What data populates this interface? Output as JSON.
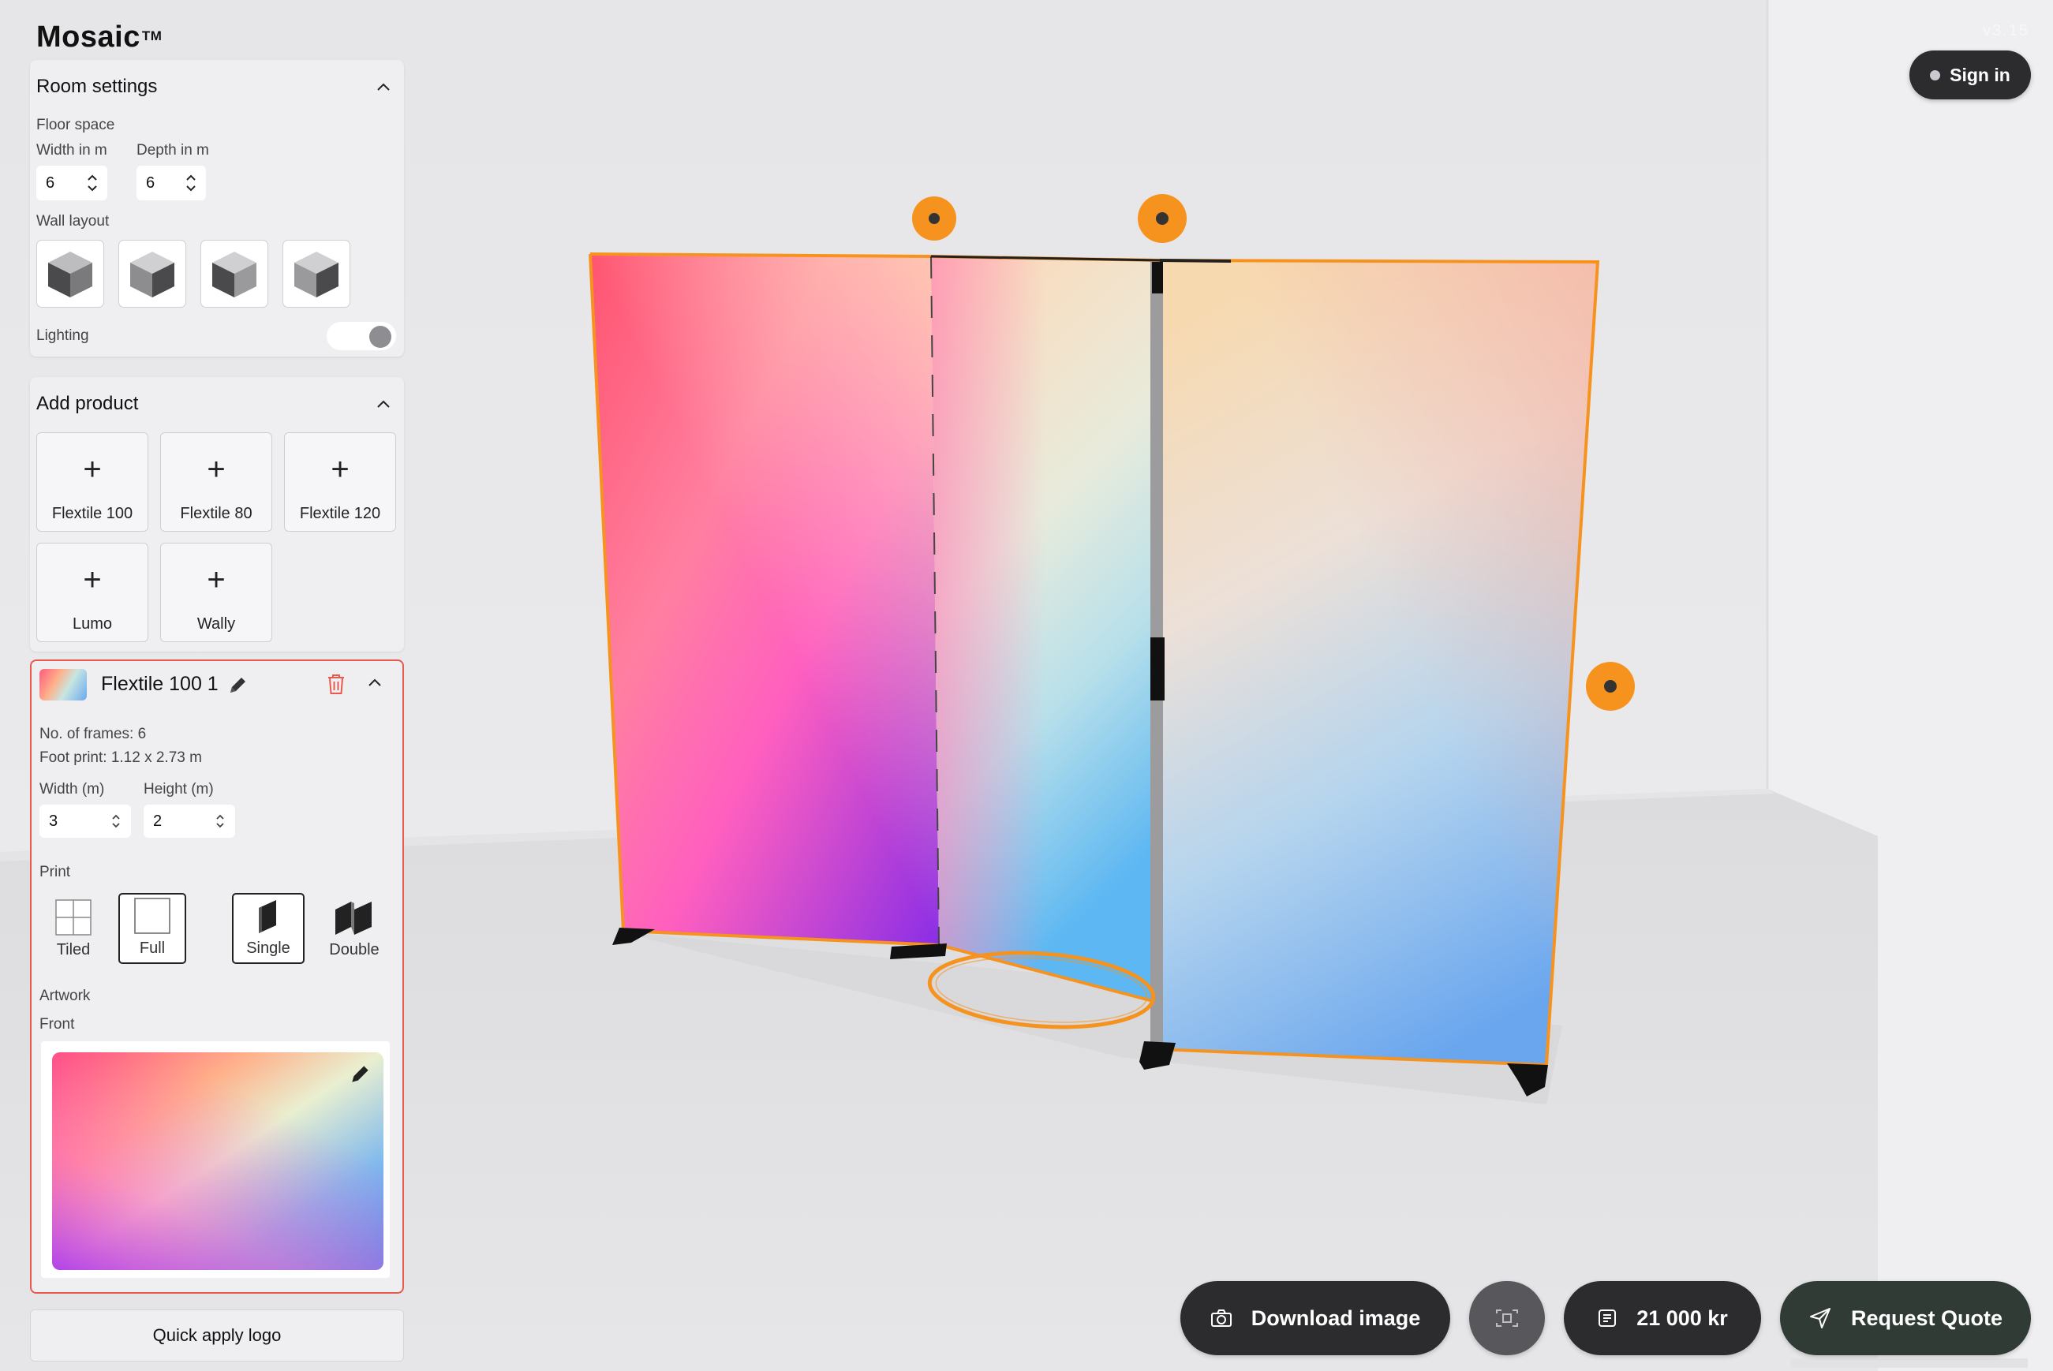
{
  "app": {
    "brand": "Mosaic",
    "trademark": "TM",
    "version": "v3.15"
  },
  "header": {
    "sign_in_label": "Sign in"
  },
  "room_settings": {
    "title": "Room settings",
    "floor_space_label": "Floor space",
    "width_label": "Width in m",
    "width_value": "6",
    "depth_label": "Depth in m",
    "depth_value": "6",
    "wall_layout_label": "Wall layout",
    "lighting_label": "Lighting",
    "lighting_on": false
  },
  "add_product": {
    "title": "Add product",
    "items": [
      "Flextile 100",
      "Flextile 80",
      "Flextile 120",
      "Lumo",
      "Wally"
    ]
  },
  "selected_product": {
    "name": "Flextile 100 1",
    "frames_text": "No. of frames: 6",
    "footprint_text": "Foot print: 1.12 x 2.73 m",
    "width_label": "Width (m)",
    "width_value": "3",
    "height_label": "Height (m)",
    "height_value": "2",
    "print_label": "Print",
    "print_options": [
      "Tiled",
      "Full",
      "Single",
      "Double"
    ],
    "artwork_label": "Artwork",
    "front_label": "Front",
    "accent_color": "#e85a4f"
  },
  "quick_apply_label": "Quick apply logo",
  "toolbar": {
    "download_label": "Download image",
    "price_label": "21 000 kr",
    "quote_label": "Request Quote"
  },
  "colors": {
    "handle": "#f6931f",
    "dark_button": "#2c2c2e",
    "quote_button": "#2f3b34"
  }
}
